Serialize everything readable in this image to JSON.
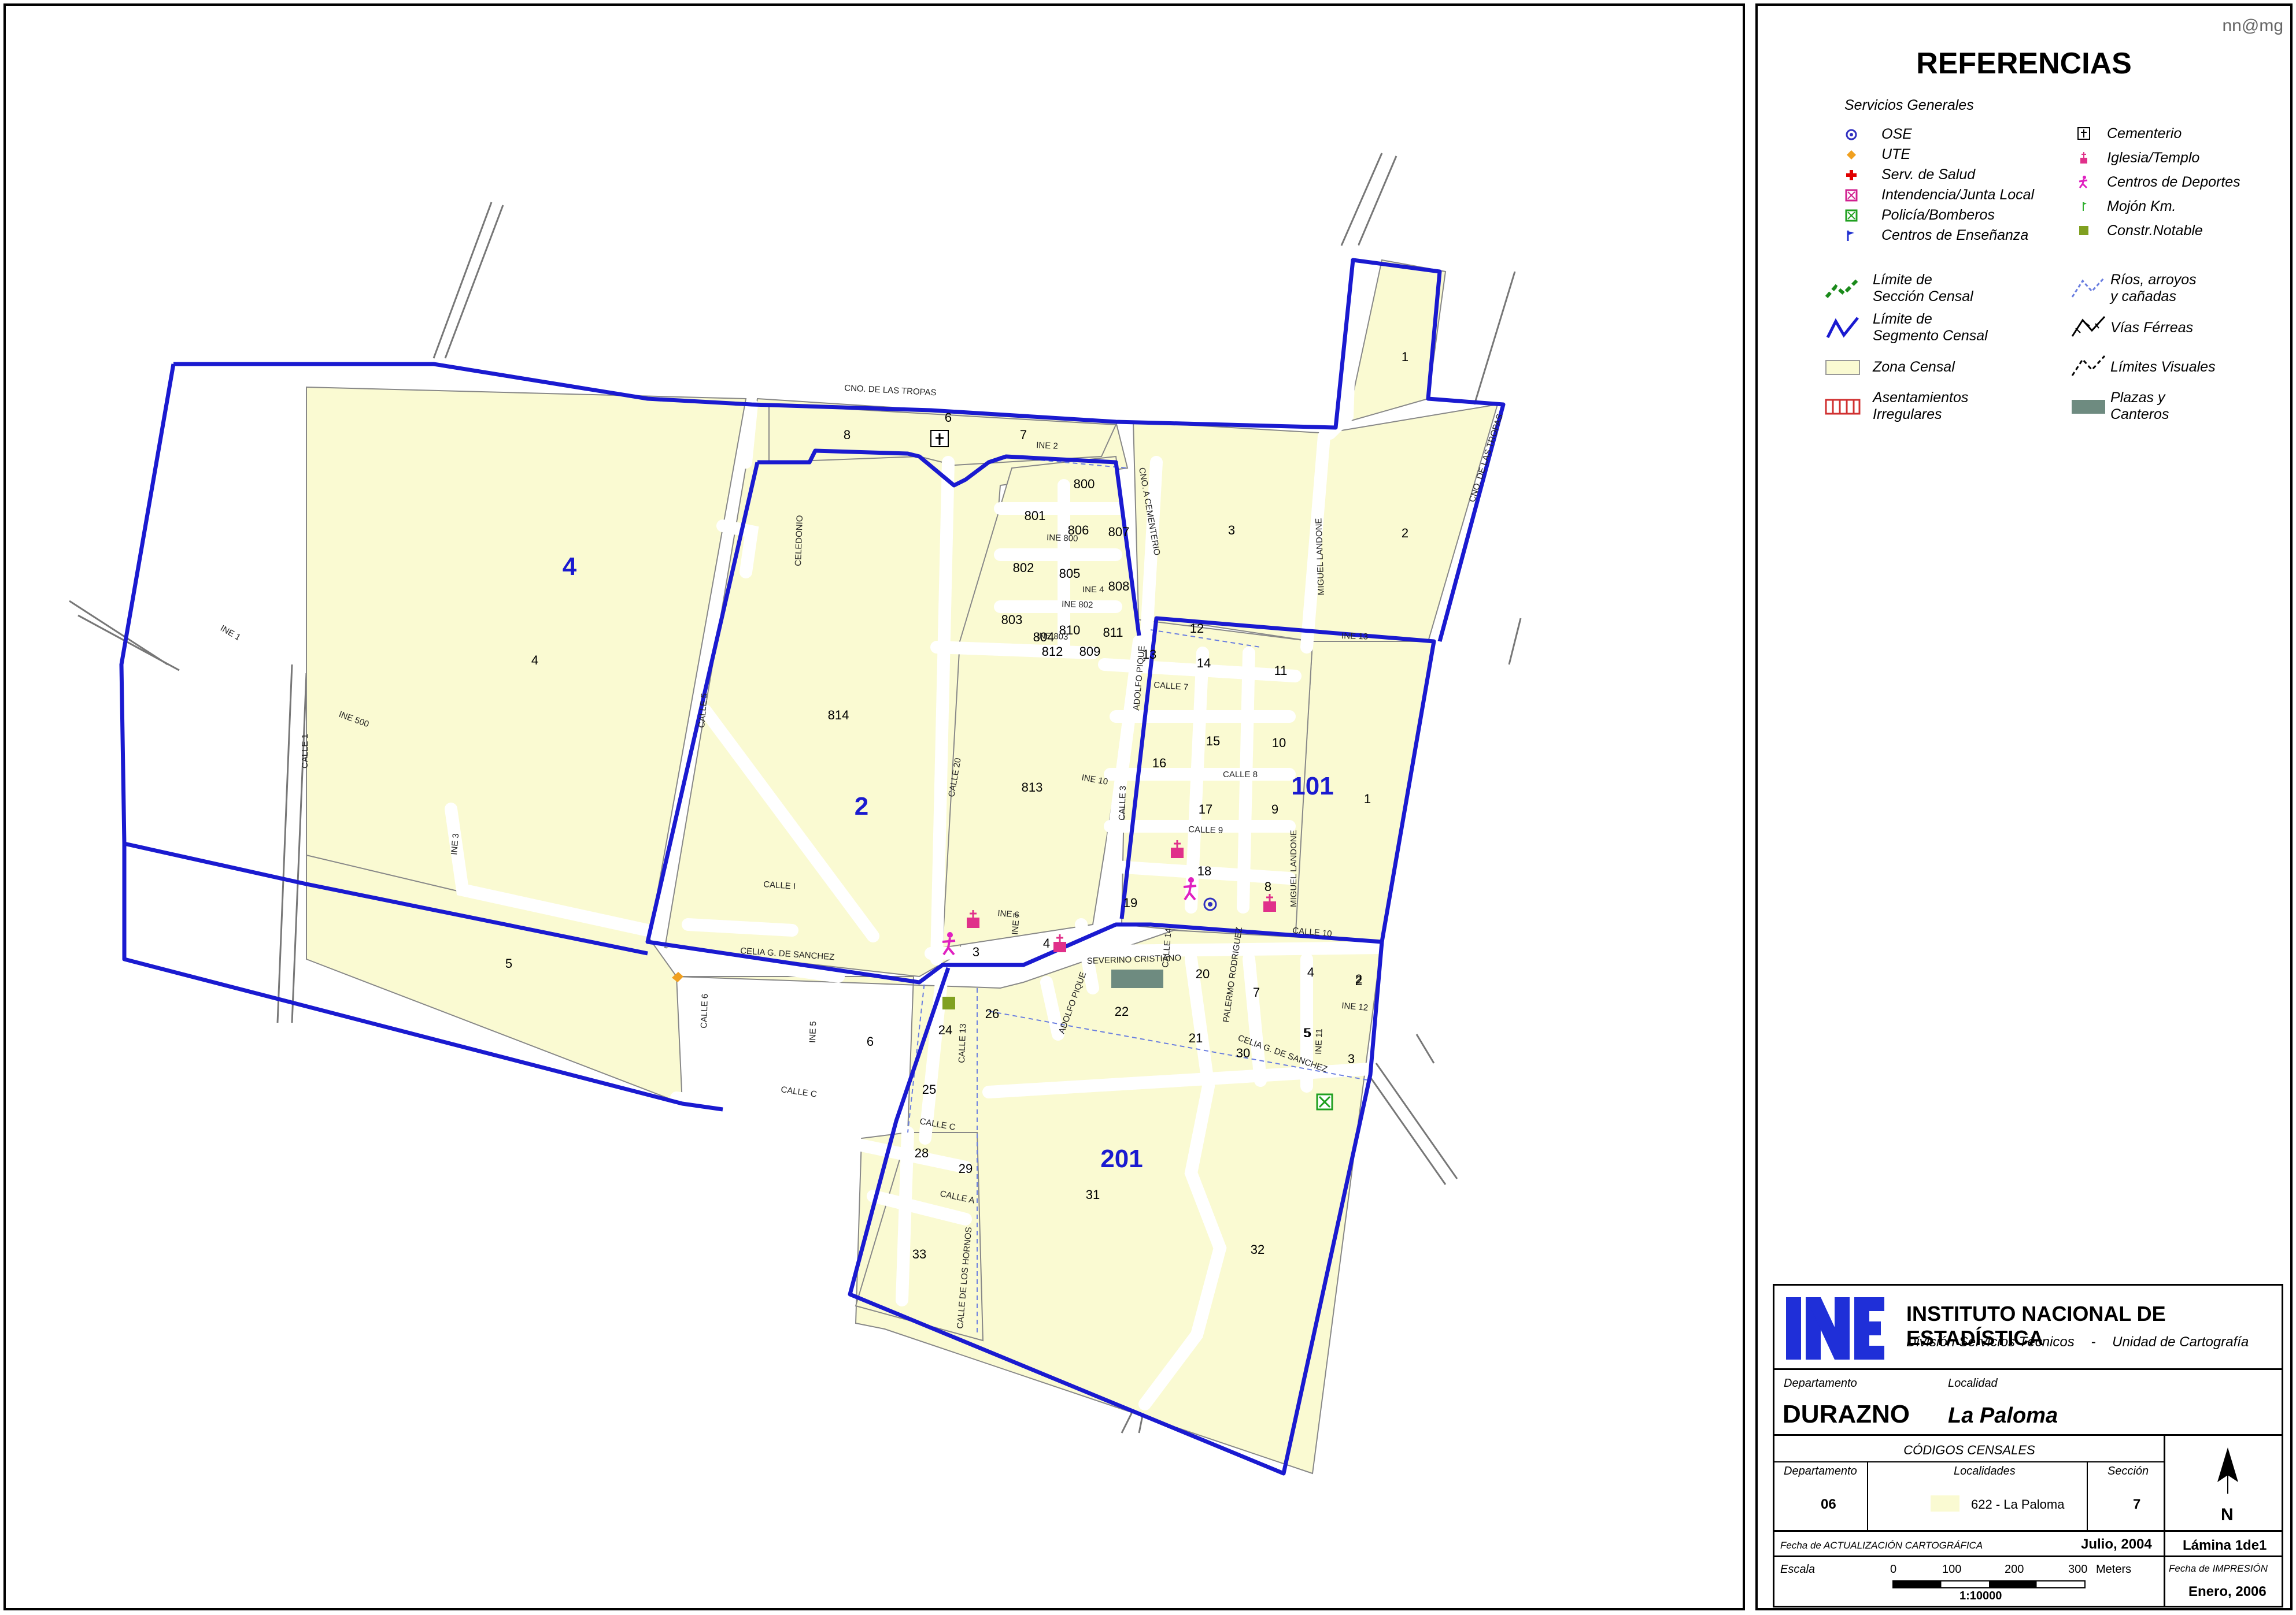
{
  "credit": "nn@mg",
  "legend": {
    "title": "REFERENCIAS",
    "services_heading": "Servicios Generales",
    "services_left": [
      {
        "label": "OSE",
        "icon": "ose-icon",
        "color": "#3030c0"
      },
      {
        "label": "UTE",
        "icon": "ute-icon",
        "color": "#f0a020"
      },
      {
        "label": "Serv. de Salud",
        "icon": "health-cross-icon",
        "color": "#e00000"
      },
      {
        "label": "Intendencia/Junta Local",
        "icon": "intendencia-icon",
        "color": "#d02090"
      },
      {
        "label": "Policía/Bomberos",
        "icon": "police-icon",
        "color": "#20a020"
      },
      {
        "label": "Centros de Enseñanza",
        "icon": "school-flag-icon",
        "color": "#2030d0"
      }
    ],
    "services_right": [
      {
        "label": "Cementerio",
        "icon": "cemetery-icon",
        "color": "#000000"
      },
      {
        "label": "Iglesia/Templo",
        "icon": "church-icon",
        "color": "#e0308a"
      },
      {
        "label": "Centros de Deportes",
        "icon": "sports-runner-icon",
        "color": "#e020c0"
      },
      {
        "label": "Mojón Km.",
        "icon": "km-marker-icon",
        "color": "#30b030"
      },
      {
        "label": "Constr.Notable",
        "icon": "notable-building-icon",
        "color": "#80a020"
      }
    ],
    "symbols_left": [
      {
        "line1": "Límite de",
        "line2": "Sección Censal",
        "icon": "section-boundary-icon"
      },
      {
        "line1": "Límite de",
        "line2": "Segmento Censal",
        "icon": "segment-boundary-icon"
      },
      {
        "line1": "Zona Censal",
        "line2": "",
        "icon": "census-zone-icon"
      },
      {
        "line1": "Asentamientos",
        "line2": "Irregulares",
        "icon": "irregular-settlement-icon"
      }
    ],
    "symbols_right": [
      {
        "line1": "Ríos, arroyos",
        "line2": "y cañadas",
        "icon": "river-icon"
      },
      {
        "line1": "Vías Férreas",
        "line2": "",
        "icon": "railway-icon"
      },
      {
        "line1": "Límites  Visuales",
        "line2": "",
        "icon": "visual-limit-icon"
      },
      {
        "line1": "Plazas y",
        "line2": "Canteros",
        "icon": "plaza-icon"
      }
    ]
  },
  "title_block": {
    "logo_text": "INE",
    "institution": "INSTITUTO NACIONAL DE ESTADÍSTICA",
    "division": "División Servicios Técnicos",
    "separator": "-",
    "unit": "Unidad de Cartografía",
    "departamento_label": "Departamento",
    "departamento_value": "DURAZNO",
    "localidad_label": "Localidad",
    "localidad_value": "La Paloma",
    "codes_title": "CÓDIGOS CENSALES",
    "codes_dep_label": "Departamento",
    "codes_loc_label": "Localidades",
    "codes_sec_label": "Sección",
    "codes_dep_value": "06",
    "codes_loc_value": "622 - La Paloma",
    "codes_sec_value": "7",
    "north_label": "N",
    "fecha_act_label": "Fecha de ACTUALIZACIÓN CARTOGRÁFICA",
    "fecha_act_value": "Julio, 2004",
    "lamina": "Lámina 1de1",
    "escala_label": "Escala",
    "scale_ticks": [
      "0",
      "100",
      "200",
      "300"
    ],
    "scale_unit": "Meters",
    "scale_ratio": "1:10000",
    "fecha_imp_label": "Fecha de IMPRESIÓN",
    "fecha_imp_value": "Enero, 2006"
  },
  "map": {
    "zone_fill": "#fafad2",
    "boundary_color": "#1a1ad0",
    "segment_labels": [
      "4",
      "2",
      "101",
      "201"
    ],
    "zone_numbers": [
      "1",
      "2",
      "3",
      "4",
      "5",
      "6",
      "7",
      "8",
      "800",
      "801",
      "802",
      "803",
      "804",
      "805",
      "806",
      "807",
      "808",
      "809",
      "810",
      "811",
      "812",
      "813",
      "814",
      "12",
      "13",
      "14",
      "11",
      "10",
      "15",
      "16",
      "17",
      "9",
      "18",
      "8",
      "19",
      "1",
      "3",
      "4",
      "5",
      "2",
      "6",
      "20",
      "7",
      "4",
      "2",
      "5",
      "3",
      "22",
      "21",
      "30",
      "24",
      "26",
      "25",
      "28",
      "29",
      "31",
      "32",
      "33"
    ],
    "street_labels": [
      "CNO. DE LAS TROPAS",
      "CNO. DE LAS TROPAS",
      "INE 1",
      "INE 500",
      "CALLE 1",
      "CALLE 5",
      "INE 3",
      "CELEDONIO",
      "CALLE I",
      "CALLE 20",
      "INE 10",
      "INE 6",
      "INE 7",
      "CELIA G. DE SANCHEZ",
      "CALLE 6",
      "INE 5",
      "CALLE C",
      "CALLE 13",
      "CALLE C",
      "CALLE A",
      "CALLE DE LOS HORNOS",
      "ADOLFO PIQUE",
      "SEVERINO CRISTIANO",
      "PALERMO RODRIGUEZ",
      "CALLE 14",
      "CALLE 3",
      "CALLE 7",
      "CALLE 8",
      "CALLE 9",
      "MIGUEL LANDONE",
      "MIGUEL LANDONE",
      "CALLE 10",
      "INE 12",
      "INE 11",
      "CELIA G. DE SANCHEZ",
      "INE 13",
      "CNO. A CEMENTERIO",
      "ADOLFO PIQUE",
      "INE 2",
      "INE 800",
      "INE 802",
      "INE 803",
      "INE 4"
    ]
  }
}
